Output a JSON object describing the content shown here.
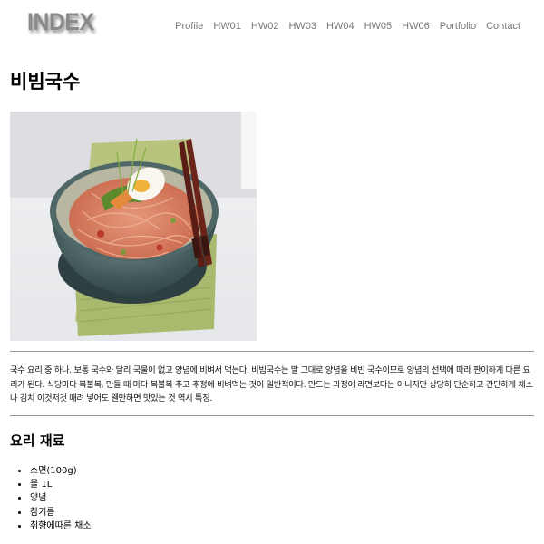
{
  "header": {
    "logo": "INDEX",
    "nav": [
      "Profile",
      "HW01",
      "HW02",
      "HW03",
      "HW04",
      "HW05",
      "HW06",
      "Portfolio",
      "Contact"
    ]
  },
  "main": {
    "title": "비빔국수",
    "description": "국수 요리 중 하나. 보통 국수와 달리 국물이 없고 양념에 비벼서 먹는다. 비빔국수는 말 그대로 양념을 비빈 국수이므로 양념의 선택에 따라 판이하게 다른 요리가 된다. 식당마다 복불복, 만들 때 마다 복불복 추고 추정에 비벼먹는 것이 일반적이다. 만드는 과정이 라면보다는 아니지만 상당히 단순하고 간단하게 채소나 김치 이것저것 때려 넣어도 웬만하면 맛있는 것 역시 특징.",
    "ingredients_title": "요리 재료",
    "ingredients": [
      "소면(100g)",
      "물 1L",
      "양념",
      "참기름",
      "취향에따른 채소"
    ]
  },
  "colors": {
    "logo": "#8a8a8a",
    "nav_text": "#777777",
    "rule": "#9a9a9a"
  }
}
